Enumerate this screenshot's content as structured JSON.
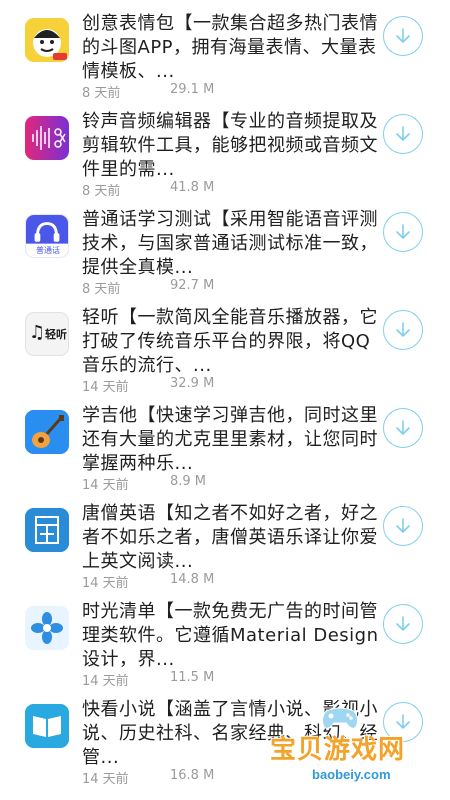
{
  "apps": [
    {
      "title": "创意表情包【一款集合超多热门表情的斗图APP，拥有海量表情、大量表情模板、...",
      "time": "8 天前",
      "size": "29.1 M",
      "icon": "emoji-meme-icon"
    },
    {
      "title": "铃声音频编辑器【专业的音频提取及剪辑软件工具，能够把视频或音频文件里的需...",
      "time": "8 天前",
      "size": "41.8 M",
      "icon": "audio-scissors-icon"
    },
    {
      "title": "普通话学习测试【采用智能语音评测技术，与国家普通话测试标准一致，提供全真模...",
      "time": "8 天前",
      "size": "92.7 M",
      "icon": "headphones-icon",
      "icon_text": "普通话"
    },
    {
      "title": "轻听【一款简风全能音乐播放器，它打破了传统音乐平台的界限，将QQ音乐的流行、...",
      "time": "14 天前",
      "size": "32.9 M",
      "icon": "music-note-icon",
      "icon_text": "轻听"
    },
    {
      "title": "学吉他【快速学习弹吉他，同时这里还有大量的尤克里里素材，让您同时掌握两种乐...",
      "time": "14 天前",
      "size": "8.9 M",
      "icon": "guitar-icon"
    },
    {
      "title": "唐僧英语【知之者不如好之者，好之者不如乐之者，唐僧英语乐译让你爱上英文阅读...",
      "time": "14 天前",
      "size": "14.8 M",
      "icon": "book-character-icon"
    },
    {
      "title": "时光清单【一款免费无广告的时间管理类软件。它遵循Material Design设计，界...",
      "time": "14 天前",
      "size": "11.5 M",
      "icon": "flower-icon"
    },
    {
      "title": "快看小说【涵盖了言情小说、影视小说、历史社科、名家经典、科幻、经管...",
      "time": "14 天前",
      "size": "16.8 M",
      "icon": "open-book-icon"
    }
  ],
  "watermark": {
    "main": "宝贝游戏网",
    "sub": "baobeiy.com"
  },
  "colors": {
    "accent": "#7fd0ec",
    "text": "#1f1f1f",
    "meta": "#9b9b9b"
  }
}
